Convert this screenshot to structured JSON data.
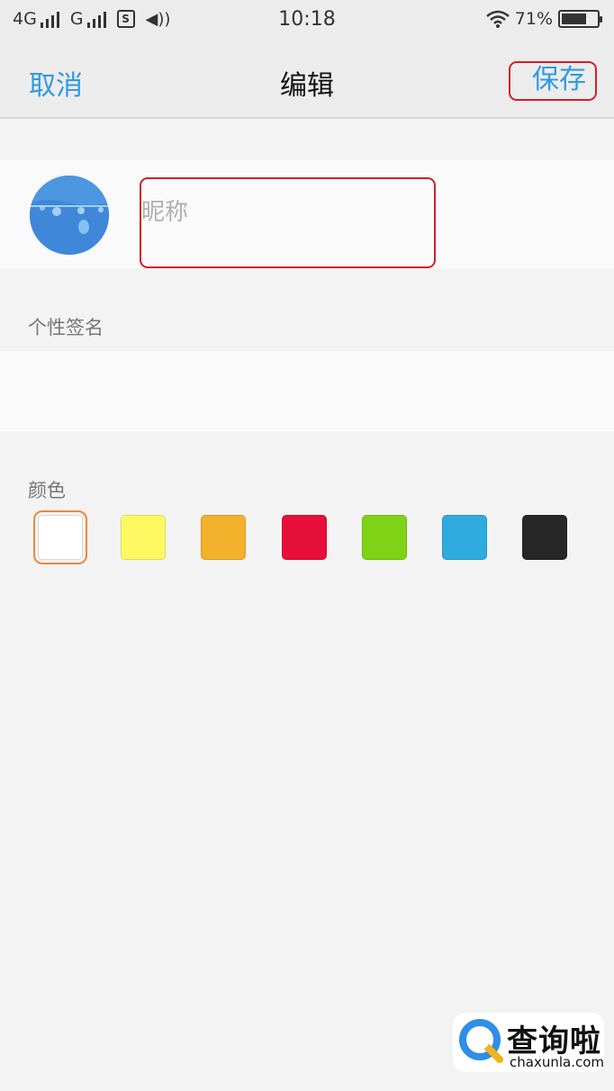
{
  "status_bar": {
    "network1": "4G",
    "network2": "G",
    "sim": "S",
    "time": "10:18",
    "battery": "71%",
    "battery_level": 0.71
  },
  "nav": {
    "cancel_label": "取消",
    "title": "编辑",
    "save_label": "保存"
  },
  "profile": {
    "nickname_placeholder": "昵称",
    "nickname_value": ""
  },
  "signature": {
    "label": "个性签名",
    "value": ""
  },
  "color_picker": {
    "label": "颜色",
    "swatches": [
      "#ffffff",
      "#fef962",
      "#f4b12c",
      "#e7103a",
      "#7fd316",
      "#2fabe0",
      "#272727"
    ],
    "selected_index": 0
  },
  "watermark": {
    "text": "查询啦",
    "url": "chaxunla.com"
  }
}
